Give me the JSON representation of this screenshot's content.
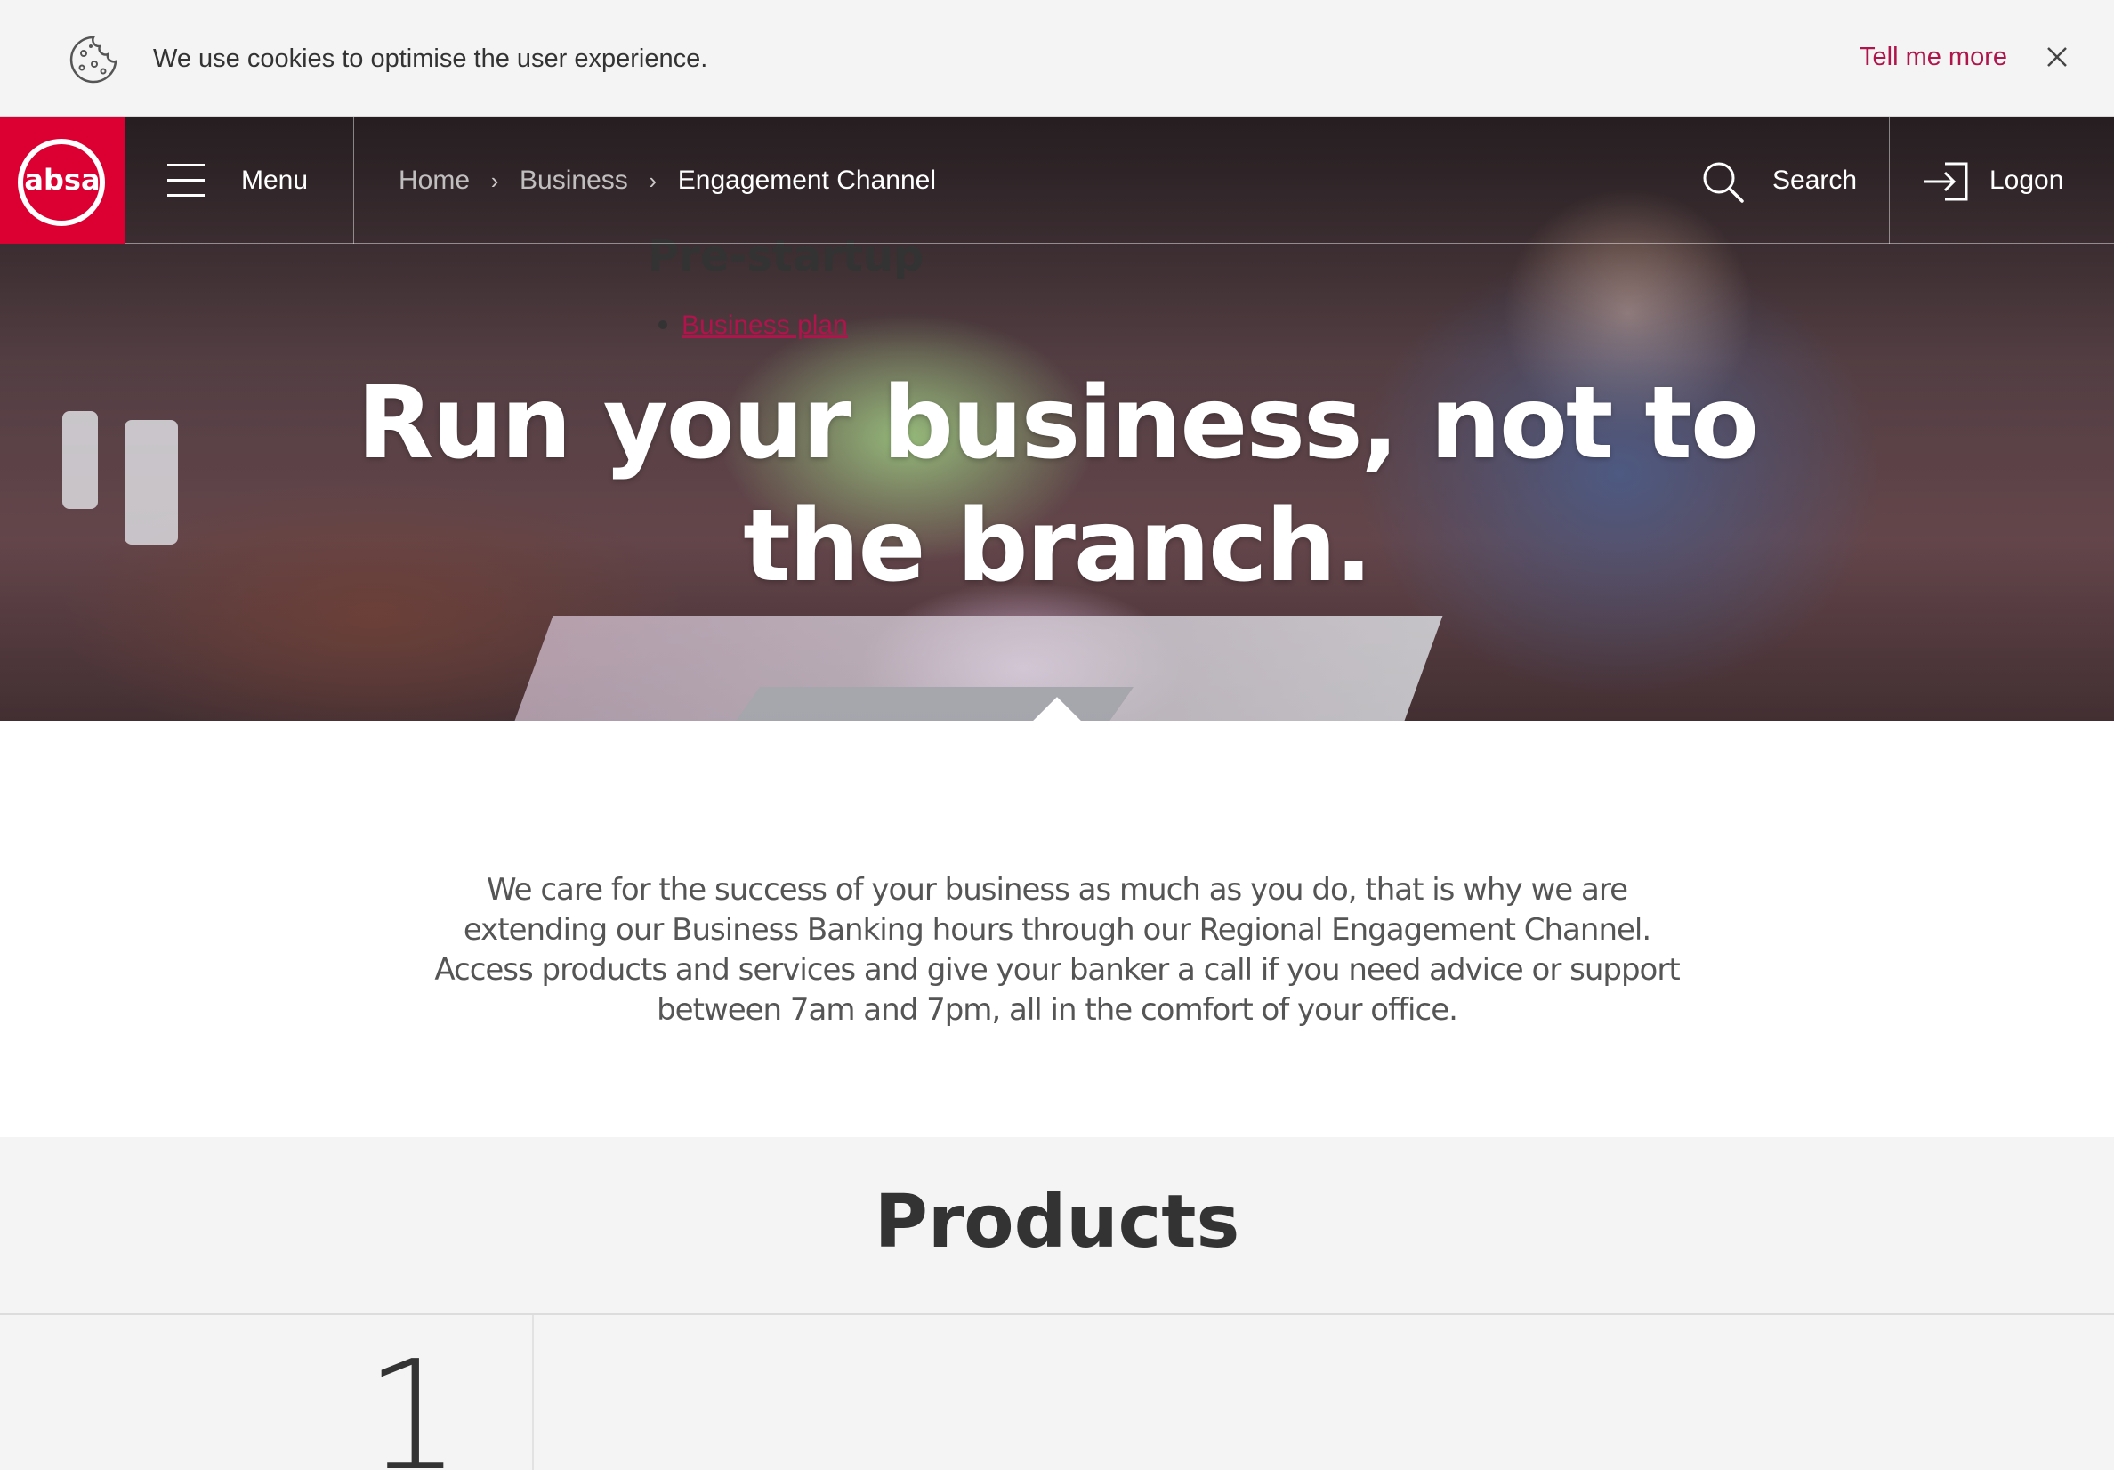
{
  "cookie_banner": {
    "icon": "cookie-icon",
    "message": "We use cookies to optimise the user experience.",
    "link_label": "Tell me more",
    "close_icon": "close-icon"
  },
  "nav": {
    "logo_text": "absa",
    "menu_label": "Menu",
    "breadcrumb": [
      {
        "label": "Home"
      },
      {
        "label": "Business"
      },
      {
        "label": "Engagement Channel"
      }
    ],
    "search_label": "Search",
    "logon_label": "Logon"
  },
  "hero": {
    "title_line1": "Run your business, not to",
    "title_line2": "the branch."
  },
  "intro": {
    "text": "We care for the success of your business as much as you do, that is why we are extending our Business Banking hours through our Regional Engagement Channel. Access products and services and give your banker a call if you need advice or support between 7am and 7pm, all in the comfort of your office."
  },
  "products": {
    "title": "Products",
    "steps": [
      {
        "number": "1",
        "title": "Pre-startup",
        "items": [
          "Business plan"
        ]
      }
    ]
  },
  "colors": {
    "brand_red": "#dc0032",
    "link_red": "#af144b",
    "cookie_bg": "#f4f4f4",
    "products_bg": "#f4f4f4"
  }
}
